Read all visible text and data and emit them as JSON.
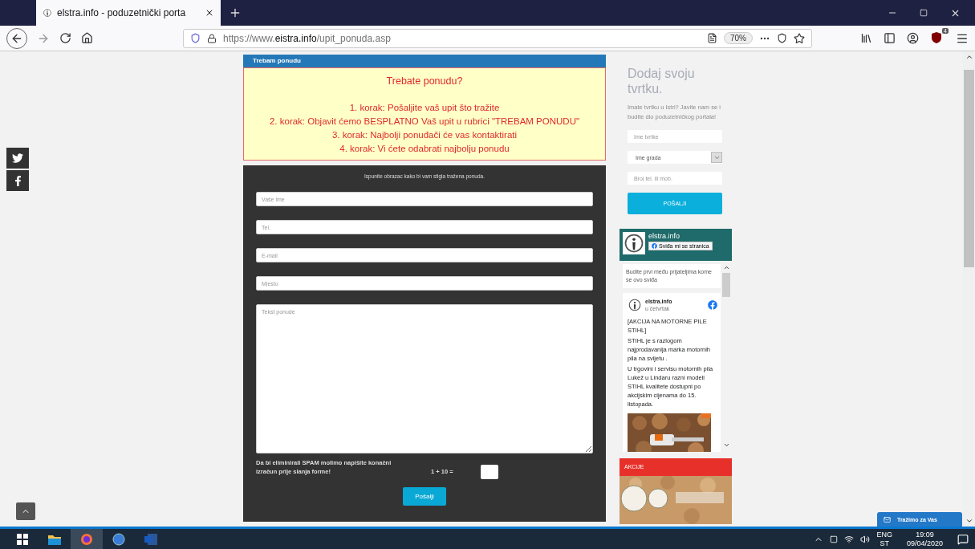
{
  "browser": {
    "tab_title": "elstra.info - poduzetnički porta",
    "url": {
      "prefix": "https://www.",
      "domain": "eistra.info",
      "path": "/upit_ponuda.asp"
    },
    "zoom": "70%",
    "badge": "4"
  },
  "request_box": {
    "header": "Trebam ponudu",
    "title": "Trebate ponudu?",
    "steps": [
      "1. korak: Pošaljite vaš upit što tražite",
      "2. korak: Objavit ćemo BESPLATNO Vaš upit u rubrici \"TREBAM PONUDU\"",
      "3. korak: Najbolji ponuđači će vas kontaktirati",
      "4. korak: Vi ćete odabrati najbolju ponudu"
    ]
  },
  "form": {
    "intro": "Ispunite obrazac kako bi vam stigla tražena ponuda.",
    "fields": [
      {
        "placeholder": "Vaše ime"
      },
      {
        "placeholder": "Tel."
      },
      {
        "placeholder": "E-mail"
      },
      {
        "placeholder": "Mjesto"
      }
    ],
    "message": {
      "placeholder": "Tekst ponude"
    },
    "spam_note": "Da bi eliminirali SPAM molimo napišite konačni izračun prije slanja forme!",
    "captcha": "1 + 10 =",
    "submit": "Pošalji"
  },
  "sidebar": {
    "heading": "Dodaj svoju tvrtku.",
    "text": "Imate tvrtku u Istri? Javite nam se i budite dio poduzetničkog portala!",
    "company_field": {
      "placeholder": "Ime tvrtke"
    },
    "city_select": {
      "value": "Ime grada"
    },
    "phone_field": {
      "placeholder": "Broj tel. ili mob."
    },
    "button": "POŠALJI"
  },
  "facebook": {
    "page_name": "elstra.info",
    "like": "Sviđa mi se stranica",
    "friends": "Budite prvi među prijateljima kome se ovo sviđa",
    "post": {
      "author": "elstra.info",
      "time": "u četvrtak",
      "paragraphs": [
        "[AKCIJA NA MOTORNE PILE STIHL]",
        "STIHL je s razlogom najprodavanija marka motornih pila na svijetu .",
        "U trgovini i servisu motornih pila Lukež u Lindaru razni modeli STIHL kvalitete dostupni po akcijskim cijenama do 15. listopada."
      ]
    }
  },
  "promo": {
    "header": "AKCIJE"
  },
  "chat": {
    "label": "Tražimo za Vas"
  },
  "taskbar": {
    "language": "ENG",
    "layout": "ST",
    "time": "19:09",
    "date": "09/04/2020"
  }
}
